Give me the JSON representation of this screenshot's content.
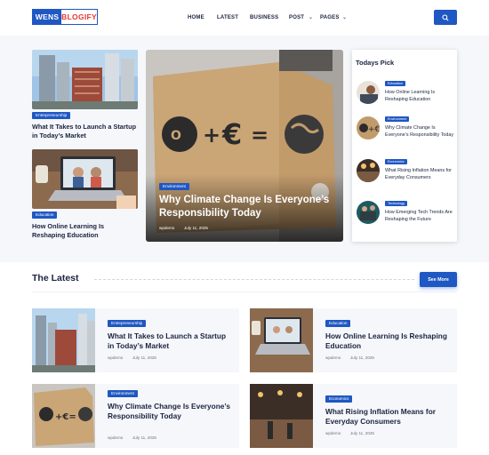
{
  "brand": {
    "part1": "WENS",
    "part2": "BLOGIFY"
  },
  "nav": {
    "home": "HOME",
    "latest": "LATEST",
    "business": "BUSINESS",
    "post": "POST",
    "pages": "PAGES"
  },
  "colors": {
    "primary": "#1f57c3",
    "accent_red": "#e23a32",
    "text": "#1b2340",
    "band": "#f5f7fa"
  },
  "left_stack": [
    {
      "tag": "Entrepreneurship",
      "title": "What It Takes to Launch a Startup in Today’s Market"
    },
    {
      "tag": "Education",
      "title": "How Online Learning Is Reshaping Education"
    }
  ],
  "hero": {
    "tag": "Environment",
    "title": "Why Climate Change Is Everyone’s Responsibility Today",
    "author": "wpdemo",
    "date": "July 11, 2025"
  },
  "todays_pick": {
    "heading": "Todays Pick",
    "items": [
      {
        "tag": "Education",
        "title": "How Online Learning Is Reshaping Education"
      },
      {
        "tag": "Environment",
        "title": "Why Climate Change Is Everyone’s Responsibility Today"
      },
      {
        "tag": "Economics",
        "title": "What Rising Inflation Means for Everyday Consumers"
      },
      {
        "tag": "Technology",
        "title": "How Emerging Tech Trends Are Reshaping the Future"
      }
    ]
  },
  "latest": {
    "heading": "The Latest",
    "see_more": "See More",
    "cards": [
      {
        "tag": "Entrepreneurship",
        "title": "What It Takes to Launch a Startup in Today’s Market",
        "author": "wpdemo",
        "date": "July 11, 2025"
      },
      {
        "tag": "Education",
        "title": "How Online Learning Is Reshaping Education",
        "author": "wpdemo",
        "date": "July 11, 2025"
      },
      {
        "tag": "Environment",
        "title": "Why Climate Change Is Everyone’s Responsibility Today",
        "author": "wpdemo",
        "date": "July 11, 2025"
      },
      {
        "tag": "Economics",
        "title": "What Rising Inflation Means for Everyday Consumers",
        "author": "wpdemo",
        "date": "July 11, 2025"
      }
    ]
  }
}
